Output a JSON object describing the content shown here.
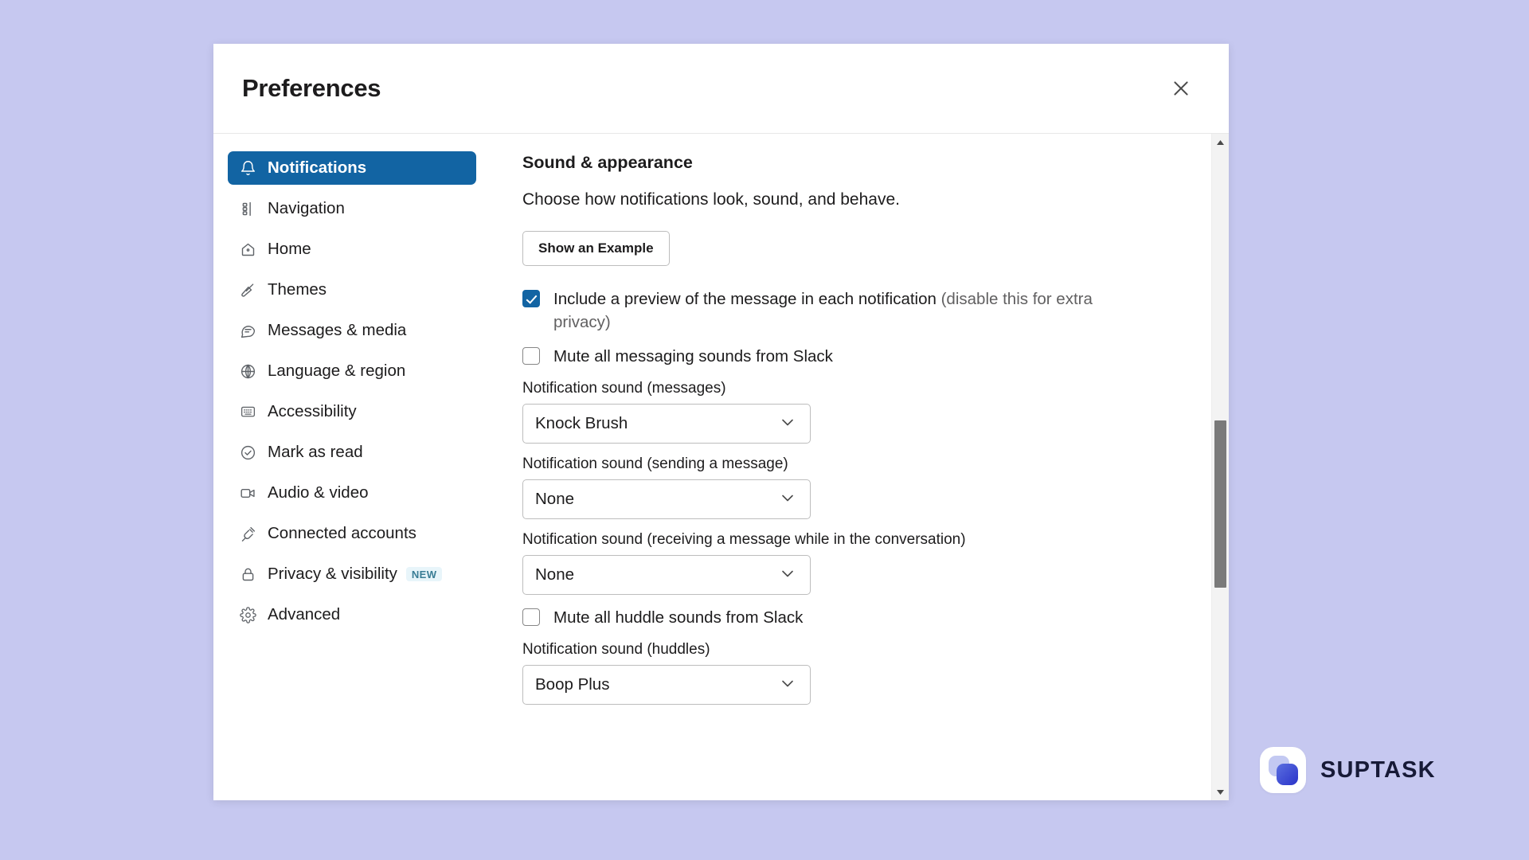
{
  "dialog": {
    "title": "Preferences",
    "close_icon": "close-icon"
  },
  "sidebar": {
    "items": [
      {
        "label": "Notifications",
        "icon": "bell-icon",
        "active": true
      },
      {
        "label": "Navigation",
        "icon": "sliders-icon",
        "active": false
      },
      {
        "label": "Home",
        "icon": "home-icon",
        "active": false
      },
      {
        "label": "Themes",
        "icon": "paintbrush-icon",
        "active": false
      },
      {
        "label": "Messages & media",
        "icon": "message-icon",
        "active": false
      },
      {
        "label": "Language & region",
        "icon": "globe-icon",
        "active": false
      },
      {
        "label": "Accessibility",
        "icon": "keyboard-icon",
        "active": false
      },
      {
        "label": "Mark as read",
        "icon": "check-circle-icon",
        "active": false
      },
      {
        "label": "Audio & video",
        "icon": "video-icon",
        "active": false
      },
      {
        "label": "Connected accounts",
        "icon": "plug-icon",
        "active": false
      },
      {
        "label": "Privacy & visibility",
        "icon": "lock-icon",
        "active": false,
        "badge": "NEW"
      },
      {
        "label": "Advanced",
        "icon": "gear-icon",
        "active": false
      }
    ]
  },
  "content": {
    "section_title": "Sound & appearance",
    "section_description": "Choose how notifications look, sound, and behave.",
    "example_button": "Show an Example",
    "checkbox_preview": {
      "label_main": "Include a preview of the message in each notification ",
      "label_muted": "(disable this for extra privacy)",
      "checked": true
    },
    "checkbox_mute_messages": {
      "label": "Mute all messaging sounds from Slack",
      "checked": false
    },
    "sound_messages": {
      "label": "Notification sound (messages)",
      "value": "Knock Brush"
    },
    "sound_sending": {
      "label": "Notification sound (sending a message)",
      "value": "None"
    },
    "sound_receiving": {
      "label": "Notification sound (receiving a message while in the conversation)",
      "value": "None"
    },
    "checkbox_mute_huddles": {
      "label": "Mute all huddle sounds from Slack",
      "checked": false
    },
    "sound_huddles": {
      "label": "Notification sound (huddles)",
      "value": "Boop Plus"
    }
  },
  "watermark": {
    "brand": "SUPTASK"
  },
  "colors": {
    "page_background": "#c6c8f0",
    "accent_blue": "#1264a3",
    "badge_background": "#e8f5fa",
    "badge_text": "#3a7d95",
    "logo_blue": "#2a33c9"
  }
}
